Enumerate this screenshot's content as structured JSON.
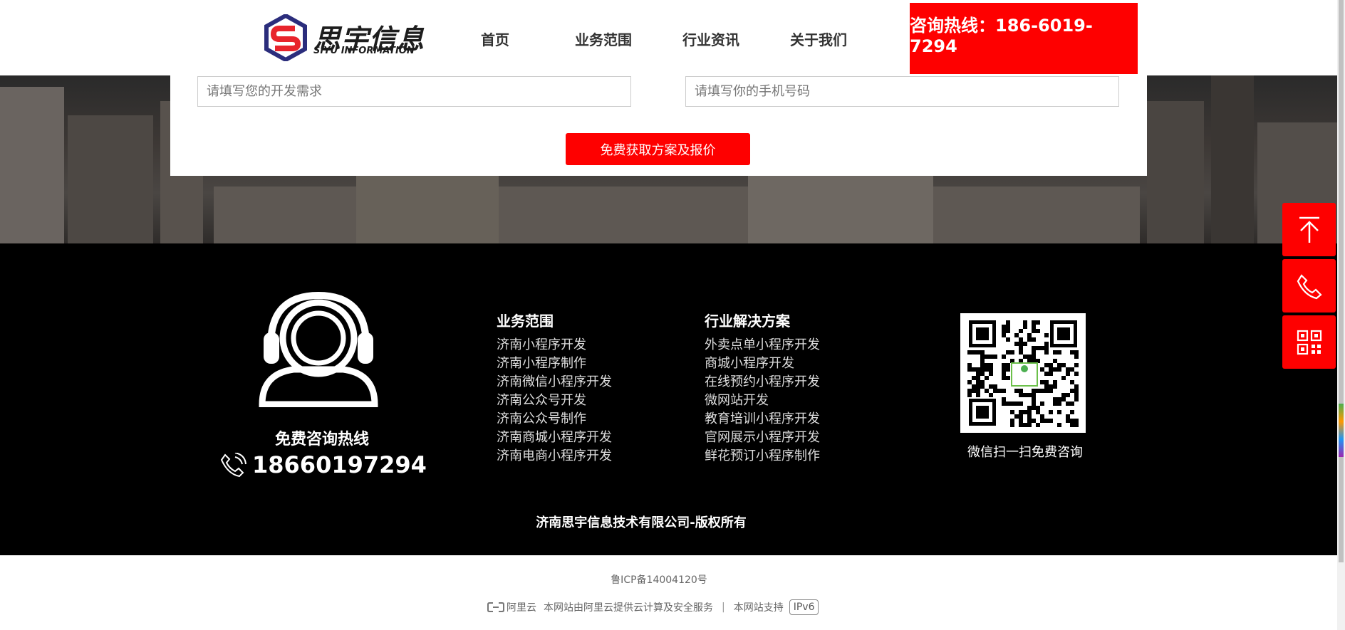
{
  "header": {
    "logo": {
      "name": "思宇信息",
      "sub": "SIYU INFORMATION"
    },
    "nav": [
      {
        "label": "首页"
      },
      {
        "label": "业务范围"
      },
      {
        "label": "行业资讯"
      },
      {
        "label": "关于我们"
      }
    ],
    "hotline": "咨询热线：186-6019-7294"
  },
  "form": {
    "demand_placeholder": "请填写您的开发需求",
    "phone_placeholder": "请填写你的手机号码",
    "submit_label": "免费获取方案及报价"
  },
  "footer": {
    "consult_label": "免费咨询热线",
    "phone": "18660197294",
    "business": {
      "title": "业务范围",
      "items": [
        "济南小程序开发",
        "济南小程序制作",
        "济南微信小程序开发",
        "济南公众号开发",
        "济南公众号制作",
        "济南商城小程序开发",
        "济南电商小程序开发"
      ]
    },
    "solutions": {
      "title": "行业解决方案",
      "items": [
        "外卖点单小程序开发",
        "商城小程序开发",
        "在线预约小程序开发",
        "微网站开发",
        "教育培训小程序开发",
        "官网展示小程序开发",
        "鲜花预订小程序制作"
      ]
    },
    "qr_caption": "微信扫一扫免费咨询",
    "copyright": "济南思宇信息技术有限公司-版权所有"
  },
  "bottom": {
    "icp": "鲁ICP备14004120号",
    "aliyun_logo": "阿里云",
    "aliyun_text": "本网站由阿里云提供云计算及安全服务",
    "separator": "|",
    "support_text": "本网站支持",
    "ipv6": "IPv6"
  },
  "colors": {
    "accent": "#fe0000",
    "footer_bg": "#000000",
    "brand_blue": "#2b2d7c",
    "brand_red": "#e8242c"
  },
  "icons": [
    "back-to-top-icon",
    "phone-icon",
    "qrcode-icon",
    "headset-agent-icon"
  ]
}
